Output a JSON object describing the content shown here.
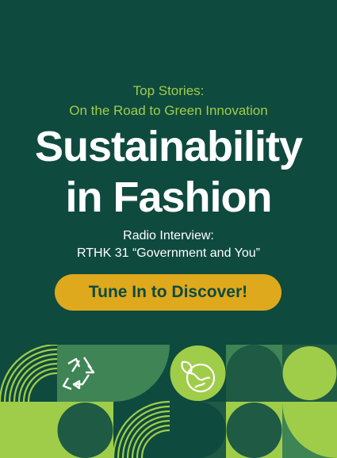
{
  "kicker": {
    "line1": "Top Stories:",
    "line2": "On the Road to Green Innovation"
  },
  "headline": {
    "line1": "Sustainability",
    "line2": "in Fashion"
  },
  "subtitle": {
    "line1": "Radio Interview:",
    "line2": "RTHK 31 “Government and You”"
  },
  "cta_label": "Tune In to Discover!",
  "colors": {
    "background": "#0f4a3f",
    "accent_green": "#9fcd49",
    "cta_gold": "#dea91d",
    "tile_mid_green": "#3e8455",
    "tile_dark_green": "#1f5a45"
  },
  "icons": [
    "recycle-icon",
    "globe-leaf-icon"
  ]
}
